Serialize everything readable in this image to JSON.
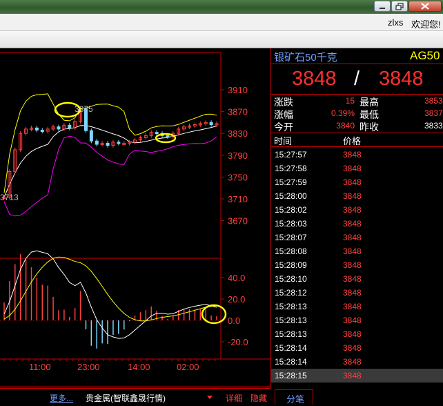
{
  "window": {
    "menu_items": [
      "zlxs",
      "欢迎您!"
    ]
  },
  "chart": {
    "price_ticks": [
      "3910",
      "3870",
      "3830",
      "3790",
      "3750",
      "3710",
      "3670"
    ],
    "macd_ticks": [
      "40.0",
      "20.0",
      "0.0",
      "-20.0"
    ],
    "time_labels": [
      "11:00",
      "23:00",
      "14:00",
      "02:00"
    ],
    "annotation_high": "3875",
    "annotation_low": "3713"
  },
  "chart_data": {
    "type": "line",
    "price_axis": {
      "ylim": [
        3640,
        3930
      ],
      "ticks": [
        3910,
        3870,
        3830,
        3790,
        3750,
        3710,
        3670
      ]
    },
    "macd_axis": {
      "ylim": [
        -30,
        50
      ],
      "ticks": [
        40,
        20,
        0,
        -20
      ]
    },
    "x_tick_labels": [
      "11:00",
      "23:00",
      "14:00",
      "02:00"
    ],
    "annotations": {
      "high": 3875,
      "low": 3713
    },
    "series": [
      {
        "values": [
          3713,
          3760,
          3800,
          3830,
          3838,
          3840,
          3836,
          3834,
          3838,
          3842,
          3838,
          3845,
          3840,
          3852,
          3875,
          3835,
          3816,
          3810,
          3812,
          3808,
          3814,
          3812,
          3812,
          3814,
          3818,
          3822,
          3826,
          3832,
          3830,
          3826,
          3824,
          3830,
          3838,
          3842,
          3844,
          3846,
          3848,
          3850,
          3846,
          3848
        ]
      }
    ]
  },
  "quote": {
    "title": "银矿石50千克",
    "code": "AG50",
    "price_a": "3848",
    "separator": "/",
    "price_b": "3848",
    "rows": [
      {
        "l1": "涨跌",
        "v1": "15",
        "l2": "最高",
        "v2": "3853"
      },
      {
        "l1": "涨幅",
        "v1": "0.39%",
        "l2": "最低",
        "v2": "3837"
      },
      {
        "l1": "今开",
        "v1": "3840",
        "l2": "昨收",
        "v2": "3833"
      }
    ],
    "col_time": "时间",
    "col_price": "价格"
  },
  "ticks": [
    {
      "time": "15:27:57",
      "price": "3848"
    },
    {
      "time": "15:27:58",
      "price": "3848"
    },
    {
      "time": "15:27:59",
      "price": "3848"
    },
    {
      "time": "15:28:00",
      "price": "3848"
    },
    {
      "time": "15:28:02",
      "price": "3848"
    },
    {
      "time": "15:28:03",
      "price": "3848"
    },
    {
      "time": "15:28:07",
      "price": "3848"
    },
    {
      "time": "15:28:08",
      "price": "3848"
    },
    {
      "time": "15:28:09",
      "price": "3848"
    },
    {
      "time": "15:28:10",
      "price": "3848"
    },
    {
      "time": "15:28:12",
      "price": "3848"
    },
    {
      "time": "15:28:13",
      "price": "3848"
    },
    {
      "time": "15:28:13",
      "price": "3848"
    },
    {
      "time": "15:28:13",
      "price": "3848"
    },
    {
      "time": "15:28:14",
      "price": "3848"
    },
    {
      "time": "15:28:14",
      "price": "3848"
    },
    {
      "time": "15:28:15",
      "price": "3848"
    }
  ],
  "bottom": {
    "more": "更多...",
    "source": "贵金属(智联鑫晟行情)",
    "detail": "详细",
    "hide": "隐藏",
    "tab": "分笔"
  },
  "colors": {
    "up": "#ff4040",
    "axis_red": "#cc0000",
    "highlight": "#ffff00",
    "bb_upper": "#ffff00",
    "bb_lower": "#ff00ff",
    "macd_neg": "#7fd7ff"
  }
}
